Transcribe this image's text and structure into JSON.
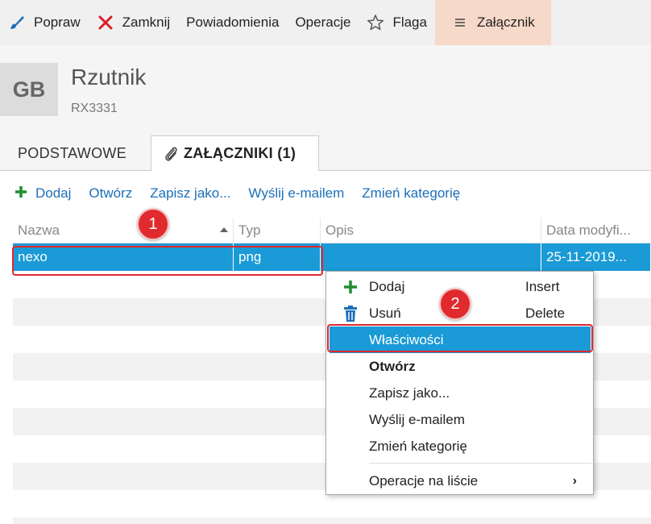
{
  "toolbar": {
    "items": [
      {
        "label": "Popraw",
        "icon": "brush-icon"
      },
      {
        "label": "Zamknij",
        "icon": "close-icon"
      },
      {
        "label": "Powiadomienia",
        "icon": ""
      },
      {
        "label": "Operacje",
        "icon": ""
      },
      {
        "label": "Flaga",
        "icon": "star-outline-icon"
      },
      {
        "label": "Załącznik",
        "icon": "hamburger-icon"
      }
    ]
  },
  "header": {
    "avatar_initials": "GB",
    "title": "Rzutnik",
    "subtitle": "RX3331"
  },
  "tabs": [
    {
      "label": "PODSTAWOWE"
    },
    {
      "label": "ZAŁĄCZNIKI (1)",
      "icon": "paperclip-icon"
    }
  ],
  "actions": [
    "Dodaj",
    "Otwórz",
    "Zapisz jako...",
    "Wyślij e-mailem",
    "Zmień kategorię"
  ],
  "grid": {
    "columns": [
      "Nazwa",
      "Typ",
      "Opis",
      "Data modyfi..."
    ],
    "rows": [
      {
        "nazwa": "nexo",
        "typ": "png",
        "opis": "",
        "data": "25-11-2019..."
      }
    ]
  },
  "context_menu": {
    "items": [
      {
        "label": "Dodaj",
        "shortcut": "Insert",
        "icon": "plus-icon"
      },
      {
        "label": "Usuń",
        "shortcut": "Delete",
        "icon": "trash-icon"
      },
      {
        "label": "Właściwości",
        "shortcut": "",
        "icon": ""
      },
      {
        "label": "Otwórz",
        "shortcut": "",
        "icon": ""
      },
      {
        "label": "Zapisz jako...",
        "shortcut": "",
        "icon": ""
      },
      {
        "label": "Wyślij e-mailem",
        "shortcut": "",
        "icon": ""
      },
      {
        "label": "Zmień kategorię",
        "shortcut": "",
        "icon": ""
      },
      {
        "label": "Operacje na liście",
        "shortcut": "",
        "icon": "chevron-right-icon"
      }
    ]
  },
  "annotations": [
    "1",
    "2"
  ],
  "colors": {
    "selection": "#1a9ad6",
    "link": "#1d6fb8",
    "highlight_red": "#e0282e",
    "active_tab_bg": "#f7d9c9",
    "plus_green": "#1e8f2e"
  }
}
